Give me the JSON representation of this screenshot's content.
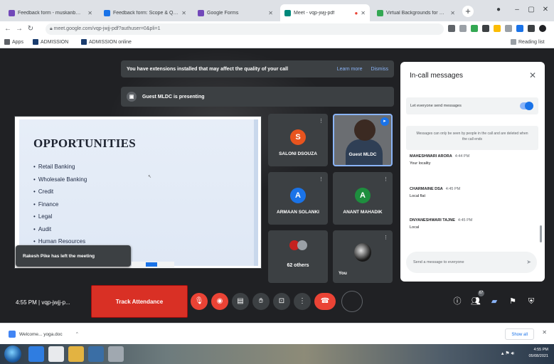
{
  "browser": {
    "tabs": [
      {
        "title": "Feedback form - muskanb@ ...",
        "favicon_color": "#7248b9"
      },
      {
        "title": "Feedback form: Scope & Qu...",
        "favicon_color": "#1a73e8"
      },
      {
        "title": "Google Forms",
        "favicon_color": "#7248b9"
      },
      {
        "title": "Meet - vqp-jwjj-pdf",
        "favicon_color": "#00897b"
      },
      {
        "title": "Virtual Backgrounds for Goo...",
        "favicon_color": "#34a853"
      }
    ],
    "new_tab": "+",
    "url": "meet.google.com/vqp-jwjj-pdf?authuser=0&pli=1",
    "bookmarks": [
      "Apps",
      "ADMISSION",
      "ADMISSION online"
    ],
    "reading_list": "Reading list"
  },
  "meet": {
    "extension_banner": {
      "text": "You have extensions installed that may affect the quality of your call",
      "learn_more": "Learn more",
      "dismiss": "Dismiss"
    },
    "presenting_banner": "Guest MLDC is presenting",
    "slide": {
      "title": "OPPORTUNITIES",
      "items": [
        "Retail Banking",
        "Wholesale Banking",
        "Credit",
        "Finance",
        "Legal",
        "Audit",
        "Human Resources"
      ]
    },
    "toast": "Rakesh Pike has left the meeting",
    "tiles": {
      "saloni": {
        "name": "SALONI DSOUZA",
        "initial": "S",
        "color": "#e8541e"
      },
      "guest": {
        "name": "Guest MLDC"
      },
      "armaan": {
        "name": "ARMAAN SOLANKI",
        "initial": "A",
        "color": "#1a73e8"
      },
      "anant": {
        "name": "ANANT MAHADIK",
        "initial": "A",
        "color": "#1e8e3e"
      },
      "others": {
        "name": "62 others"
      },
      "you": {
        "name": "You"
      }
    },
    "chat": {
      "title": "In-call messages",
      "toggle_label": "Let everyone send messages",
      "toggle_on": true,
      "notice": "Messages can only be seen by people in the call and are deleted when the call ends",
      "messages": [
        {
          "sender": "MAHESHWARI ARORA",
          "time": "4:44 PM",
          "body": "Your locality"
        },
        {
          "sender": "CHARMAINE DSA",
          "time": "4:45 PM",
          "body": "Local flat"
        },
        {
          "sender": "DNYANESHWARI TAJNE",
          "time": "4:45 PM",
          "body": "Local"
        }
      ],
      "input_placeholder": "Send a message to everyone"
    },
    "controls": {
      "meeting_info": "4:55 PM  |  vqp-jwjj-p...",
      "track_attendance": "Track Attendance",
      "people_count": "67"
    }
  },
  "downloads": {
    "file": "Welcome... yoga.doc",
    "show_all": "Show all"
  },
  "taskbar": {
    "time": "4:55 PM",
    "date": "05/08/2021"
  },
  "colors": {
    "meet_bg": "#202124",
    "accent": "#1a73e8",
    "end_call": "#ea4335",
    "track_btn": "#d93025"
  }
}
